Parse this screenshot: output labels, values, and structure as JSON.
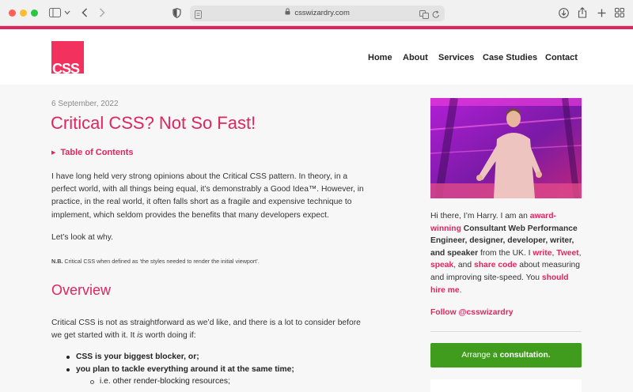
{
  "browser": {
    "url": "csswizardry.com"
  },
  "header": {
    "logo_text": "CSS",
    "nav": [
      "Home",
      "About",
      "Services",
      "Case Studies",
      "Contact"
    ]
  },
  "article": {
    "date": "6 September, 2022",
    "title": "Critical CSS? Not So Fast!",
    "toc_label": "Table of Contents",
    "intro": "I have long held very strong opinions about the Critical CSS pattern. In theory, in a perfect world, with all things being equal, it’s demonstrably a Good Idea™. However, in practice, in the real world, it often falls short as a fragile and expensive technique to implement, which seldom provides the benefits that many developers expect.",
    "lets_look": "Let’s look at why.",
    "nb_label": "N.B.",
    "nb_text": "Critical CSS when defined as ‘the styles needed to render the initial viewport’.",
    "overview_heading": "Overview",
    "overview_text_1": "Critical CSS is not as straightforward as we’d like, and there is a lot to consider before we get started with it. It",
    "overview_is": "is",
    "overview_text_2": "worth doing if:",
    "bullets": [
      "CSS is your biggest blocker, or;",
      "you plan to tackle everything around it at the same time;"
    ],
    "sub_bullet": "i.e. other render-blocking resources;"
  },
  "sidebar": {
    "bio_1": "Hi there, I’m Harry. I am an",
    "bio_award": "award-winning",
    "bio_2": "Consultant Web Performance Engineer, designer, developer, writer, and speaker",
    "bio_3": "from the UK. I",
    "bio_write": "write",
    "bio_comma1": ",",
    "bio_tweet": "Tweet",
    "bio_comma2": ",",
    "bio_speak": "speak",
    "bio_and": ", and",
    "bio_share": "share code",
    "bio_4": "about measuring and improving site-speed. You",
    "bio_hire": "should hire me",
    "bio_end": ".",
    "follow": "Follow @csswizardry",
    "cta_1": "Arrange a",
    "cta_2": "consultation."
  },
  "colors": {
    "accent": "#e1245f",
    "cta_green": "#3f9c1d"
  }
}
